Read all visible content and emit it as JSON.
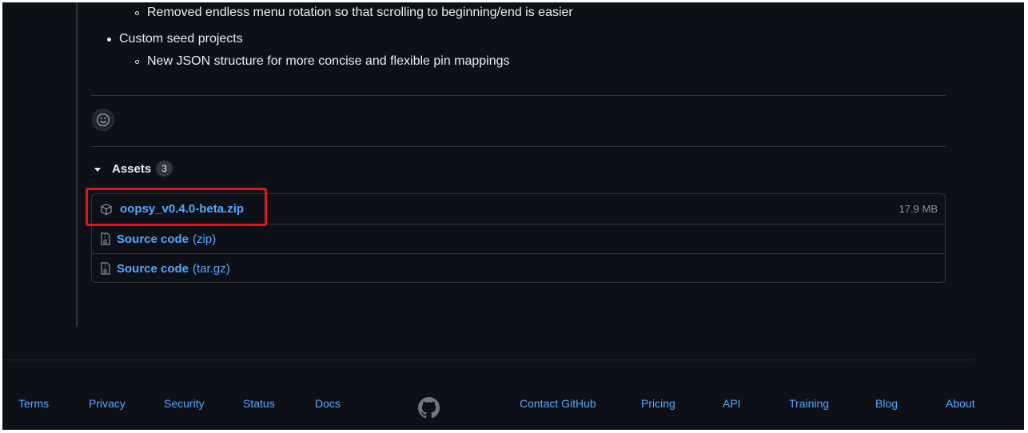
{
  "release_notes": {
    "items": [
      {
        "text": "Removed endless menu rotation so that scrolling to beginning/end is easier",
        "level": 2
      },
      {
        "text": "Custom seed projects",
        "level": 1
      },
      {
        "text": "New JSON structure for more concise and flexible pin mappings",
        "level": 2
      }
    ]
  },
  "reactions": {
    "icon": "smiley-icon"
  },
  "assets": {
    "title": "Assets",
    "count": "3",
    "files": [
      {
        "name": "oopsy_v0.4.0-beta.zip",
        "kind": "",
        "size": "17.9 MB",
        "icon": "package-icon"
      },
      {
        "name": "Source code",
        "kind": "(zip)",
        "size": "",
        "icon": "file-zip-icon"
      },
      {
        "name": "Source code",
        "kind": "(tar.gz)",
        "size": "",
        "icon": "file-zip-icon"
      }
    ]
  },
  "footer": {
    "links": [
      "Terms",
      "Privacy",
      "Security",
      "Status",
      "Docs",
      "Contact GitHub",
      "Pricing",
      "API",
      "Training",
      "Blog",
      "About"
    ],
    "logo": "github-icon"
  },
  "colors": {
    "background": "#0d1117",
    "link": "#58a6ff",
    "highlight": "#e0161c"
  }
}
